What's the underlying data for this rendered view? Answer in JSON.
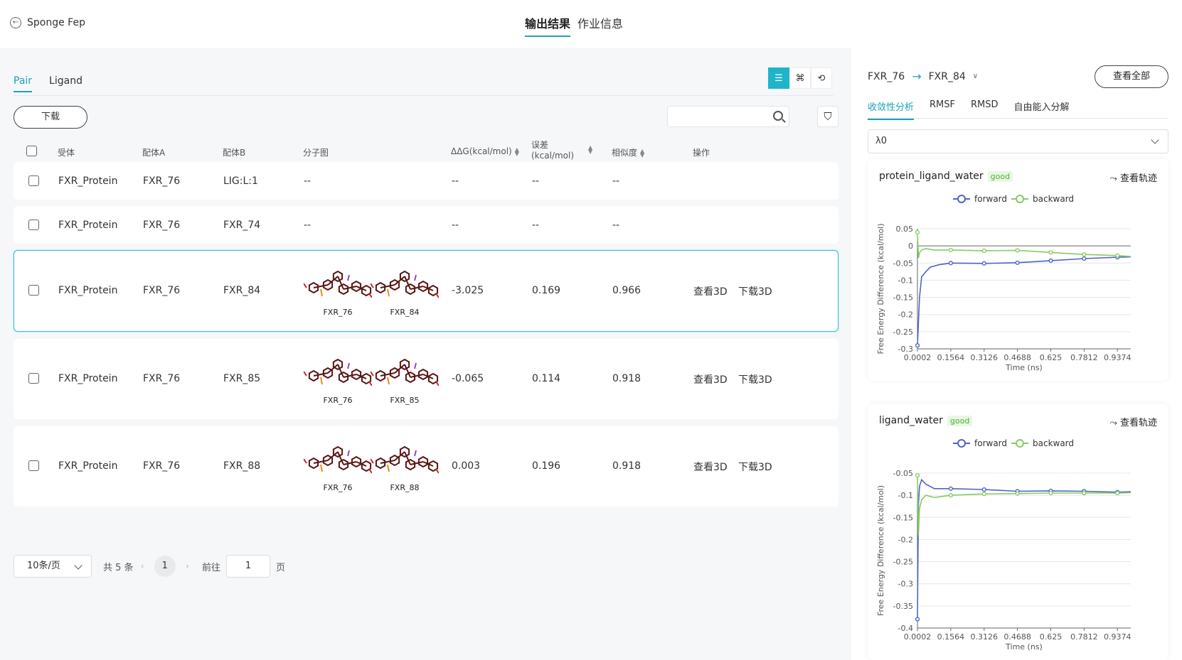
{
  "header": {
    "back_label": "Sponge Fep",
    "tabs": [
      {
        "label": "输出结果"
      },
      {
        "label": "作业信息"
      }
    ]
  },
  "left": {
    "subtabs": [
      {
        "label": "Pair"
      },
      {
        "label": "Ligand"
      }
    ],
    "download_label": "下载",
    "search_placeholder": "",
    "columns": [
      "受体",
      "配体A",
      "配体B",
      "分子图",
      "ΔΔG(kcal/mol)",
      "误差",
      "(kcal/mol)",
      "相似度",
      "操作"
    ],
    "rows": [
      {
        "receptor": "FXR_Protein",
        "ligand_a": "FXR_76",
        "ligand_b": "LIG:L:1",
        "mol": "--",
        "ddg": "--",
        "err": "--",
        "sim": "--"
      },
      {
        "receptor": "FXR_Protein",
        "ligand_a": "FXR_76",
        "ligand_b": "FXR_74",
        "mol": "--",
        "ddg": "--",
        "err": "--",
        "sim": "--"
      },
      {
        "receptor": "FXR_Protein",
        "ligand_a": "FXR_76",
        "ligand_b": "FXR_84",
        "mol_a": "FXR_76",
        "mol_b": "FXR_84",
        "ddg": "-3.025",
        "err": "0.169",
        "sim": "0.966",
        "view": "查看3D",
        "download": "下载3D"
      },
      {
        "receptor": "FXR_Protein",
        "ligand_a": "FXR_76",
        "ligand_b": "FXR_85",
        "mol_a": "FXR_76",
        "mol_b": "FXR_85",
        "ddg": "-0.065",
        "err": "0.114",
        "sim": "0.918",
        "view": "查看3D",
        "download": "下载3D"
      },
      {
        "receptor": "FXR_Protein",
        "ligand_a": "FXR_76",
        "ligand_b": "FXR_88",
        "mol_a": "FXR_76",
        "mol_b": "FXR_88",
        "ddg": "0.003",
        "err": "0.196",
        "sim": "0.918",
        "view": "查看3D",
        "download": "下载3D"
      }
    ],
    "pager": {
      "page_size": "10条/页",
      "total": "共 5 条",
      "current": "1",
      "goto_label": "前往",
      "goto_value": "1",
      "page_suffix": "页"
    }
  },
  "right": {
    "pair_a": "FXR_76",
    "pair_b": "FXR_84",
    "view_all": "查看全部",
    "tabs": [
      {
        "label": "收敛性分析"
      },
      {
        "label": "RMSF"
      },
      {
        "label": "RMSD"
      },
      {
        "label": "自由能入分解"
      }
    ],
    "lambda": "λ0",
    "trajectory_label": "查看轨迹",
    "colors": {
      "forward": "#4f64c4",
      "backward": "#86cc63",
      "accent": "#1aa3b8"
    }
  },
  "chart_data": [
    {
      "type": "line",
      "title": "protein_ligand_water",
      "badge": "good",
      "xlabel": "Time (ns)",
      "ylabel": "Free Energy Difference (kcal/mol)",
      "x_ticks": [
        "0.0002",
        "0.1564",
        "0.3126",
        "0.4688",
        "0.625",
        "0.7812",
        "0.9374"
      ],
      "y_ticks": [
        "0.05",
        "0",
        "-0.05",
        "-0.1",
        "-0.15",
        "-0.2",
        "-0.25",
        "-0.3"
      ],
      "ylim": [
        -0.3,
        0.05
      ],
      "xlim": [
        0.0002,
        1.0
      ],
      "legend": "top-center",
      "series": [
        {
          "name": "forward",
          "x": [
            0.0002,
            0.01,
            0.02,
            0.04,
            0.06,
            0.1,
            0.1564,
            0.3126,
            0.4688,
            0.625,
            0.7812,
            0.9374,
            1.0
          ],
          "values": [
            -0.29,
            -0.15,
            -0.09,
            -0.075,
            -0.062,
            -0.055,
            -0.05,
            -0.051,
            -0.049,
            -0.043,
            -0.037,
            -0.033,
            -0.032
          ]
        },
        {
          "name": "backward",
          "x": [
            0.0002,
            0.005,
            0.01,
            0.02,
            0.04,
            0.08,
            0.1564,
            0.3126,
            0.4688,
            0.625,
            0.7812,
            0.9374,
            1.0
          ],
          "values": [
            0.04,
            -0.035,
            -0.02,
            -0.012,
            -0.008,
            -0.012,
            -0.012,
            -0.014,
            -0.013,
            -0.019,
            -0.025,
            -0.028,
            -0.031
          ]
        }
      ]
    },
    {
      "type": "line",
      "title": "ligand_water",
      "badge": "good",
      "xlabel": "Time (ns)",
      "ylabel": "Free Energy Difference (kcal/mol)",
      "x_ticks": [
        "0.0002",
        "0.1564",
        "0.3126",
        "0.4688",
        "0.625",
        "0.7812",
        "0.9374"
      ],
      "y_ticks": [
        "-0.05",
        "-0.1",
        "-0.15",
        "-0.2",
        "-0.25",
        "-0.3",
        "-0.35",
        "-0.4"
      ],
      "ylim": [
        -0.4,
        -0.05
      ],
      "xlim": [
        0.0002,
        1.0
      ],
      "legend": "top-center",
      "series": [
        {
          "name": "forward",
          "x": [
            0.0002,
            0.005,
            0.01,
            0.02,
            0.04,
            0.08,
            0.1564,
            0.3126,
            0.4688,
            0.625,
            0.7812,
            0.9374,
            1.0
          ],
          "values": [
            -0.38,
            -0.12,
            -0.08,
            -0.065,
            -0.075,
            -0.085,
            -0.085,
            -0.087,
            -0.091,
            -0.09,
            -0.091,
            -0.093,
            -0.092
          ]
        },
        {
          "name": "backward",
          "x": [
            0.0002,
            0.005,
            0.01,
            0.02,
            0.04,
            0.08,
            0.1564,
            0.3126,
            0.4688,
            0.625,
            0.7812,
            0.9374,
            1.0
          ],
          "values": [
            -0.055,
            -0.19,
            -0.13,
            -0.11,
            -0.1,
            -0.105,
            -0.1,
            -0.097,
            -0.096,
            -0.095,
            -0.095,
            -0.095,
            -0.094
          ]
        }
      ]
    }
  ]
}
